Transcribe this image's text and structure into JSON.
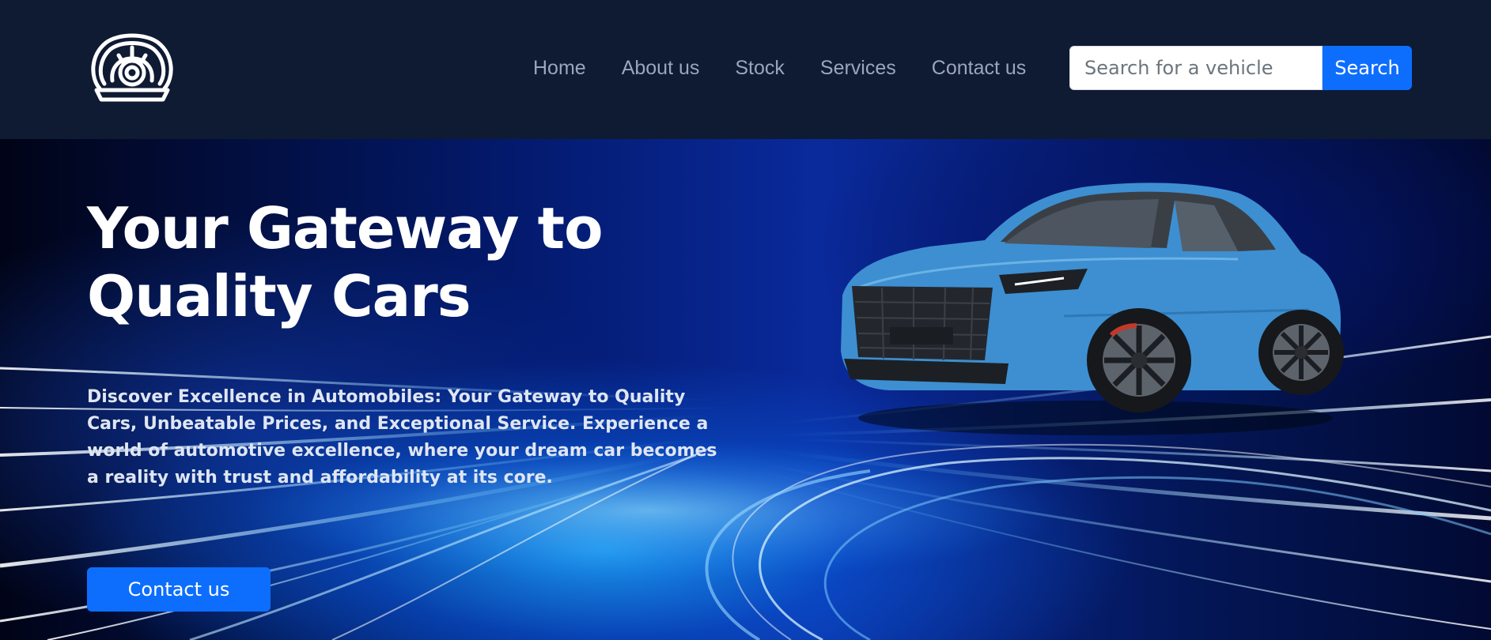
{
  "navbar": {
    "logo_icon": "shell-logo-icon",
    "links": [
      {
        "label": "Home"
      },
      {
        "label": "About us"
      },
      {
        "label": "Stock"
      },
      {
        "label": "Services"
      },
      {
        "label": "Contact us"
      }
    ],
    "search": {
      "placeholder": "Search for a vehicle",
      "value": "",
      "button_label": "Search"
    }
  },
  "hero": {
    "title": "Your Gateway to Quality Cars",
    "description": "Discover Excellence in Automobiles: Your Gateway to Quality Cars, Unbeatable Prices, and Exceptional Service. Experience a world of automotive excellence, where your dream car becomes a reality with trust and affordability at its core.",
    "cta_label": "Contact us",
    "image": "blue-suv-car-image",
    "background": "blue-light-streaks"
  },
  "colors": {
    "navbar_bg": "#0f1a33",
    "nav_link": "#9aa6bb",
    "primary": "#0d6efd",
    "hero_text": "#dfe6f2",
    "car_body": "#3d8fd1"
  }
}
